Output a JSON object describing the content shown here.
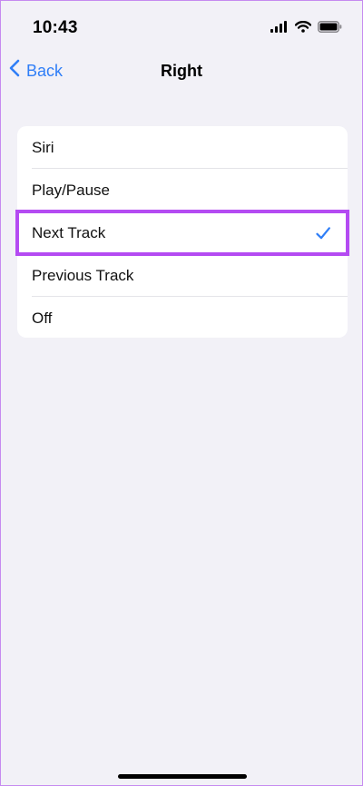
{
  "status_bar": {
    "time": "10:43",
    "icons": [
      "cellular-signal-icon",
      "wifi-icon",
      "battery-icon"
    ]
  },
  "nav": {
    "back_label": "Back",
    "title": "Right"
  },
  "options": [
    {
      "label": "Siri",
      "selected": false
    },
    {
      "label": "Play/Pause",
      "selected": false
    },
    {
      "label": "Next Track",
      "selected": true
    },
    {
      "label": "Previous Track",
      "selected": false
    },
    {
      "label": "Off",
      "selected": false
    }
  ],
  "colors": {
    "background": "#f2f1f7",
    "accent": "#2f7ef7",
    "highlight": "#b44bf2",
    "card": "#ffffff"
  }
}
